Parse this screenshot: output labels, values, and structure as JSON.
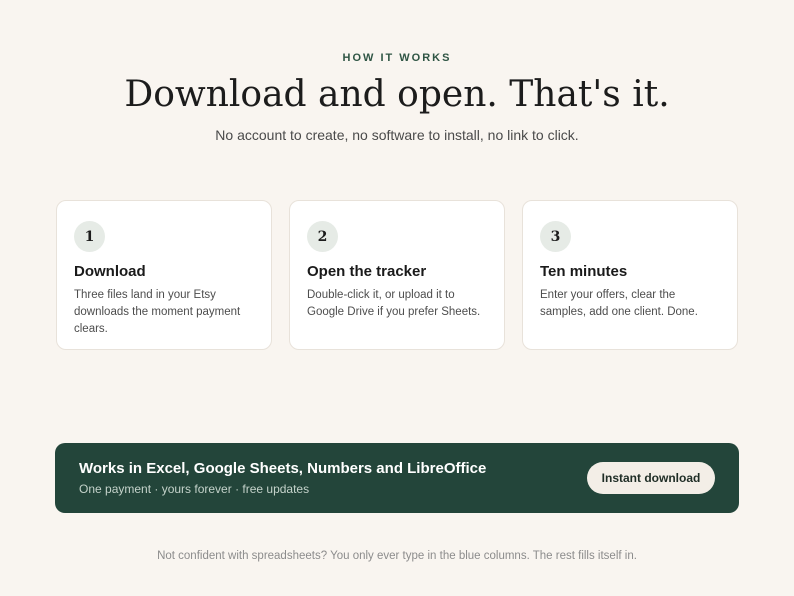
{
  "hero": {
    "eyebrow": "HOW IT WORKS",
    "headline": "Download and open. That's it.",
    "subhead": "No account to create, no software to install, no link to click."
  },
  "steps": [
    {
      "number": "1",
      "title": "Download",
      "body": "Three files land in your Etsy downloads the moment payment clears."
    },
    {
      "number": "2",
      "title": "Open the tracker",
      "body": "Double-click it, or upload it to Google Drive if you prefer Sheets."
    },
    {
      "number": "3",
      "title": "Ten minutes",
      "body": "Enter your offers, clear the samples, add one client. Done."
    }
  ],
  "banner": {
    "title": "Works in Excel, Google Sheets, Numbers and LibreOffice",
    "subtitle": "One payment · yours forever · free updates",
    "button_label": "Instant download"
  },
  "footnote": "Not confident with spreadsheets? You only ever type in the blue columns. The rest fills itself in.",
  "colors": {
    "background": "#f9f5f0",
    "accent": "#23453a",
    "eyebrow": "#2f5544"
  }
}
